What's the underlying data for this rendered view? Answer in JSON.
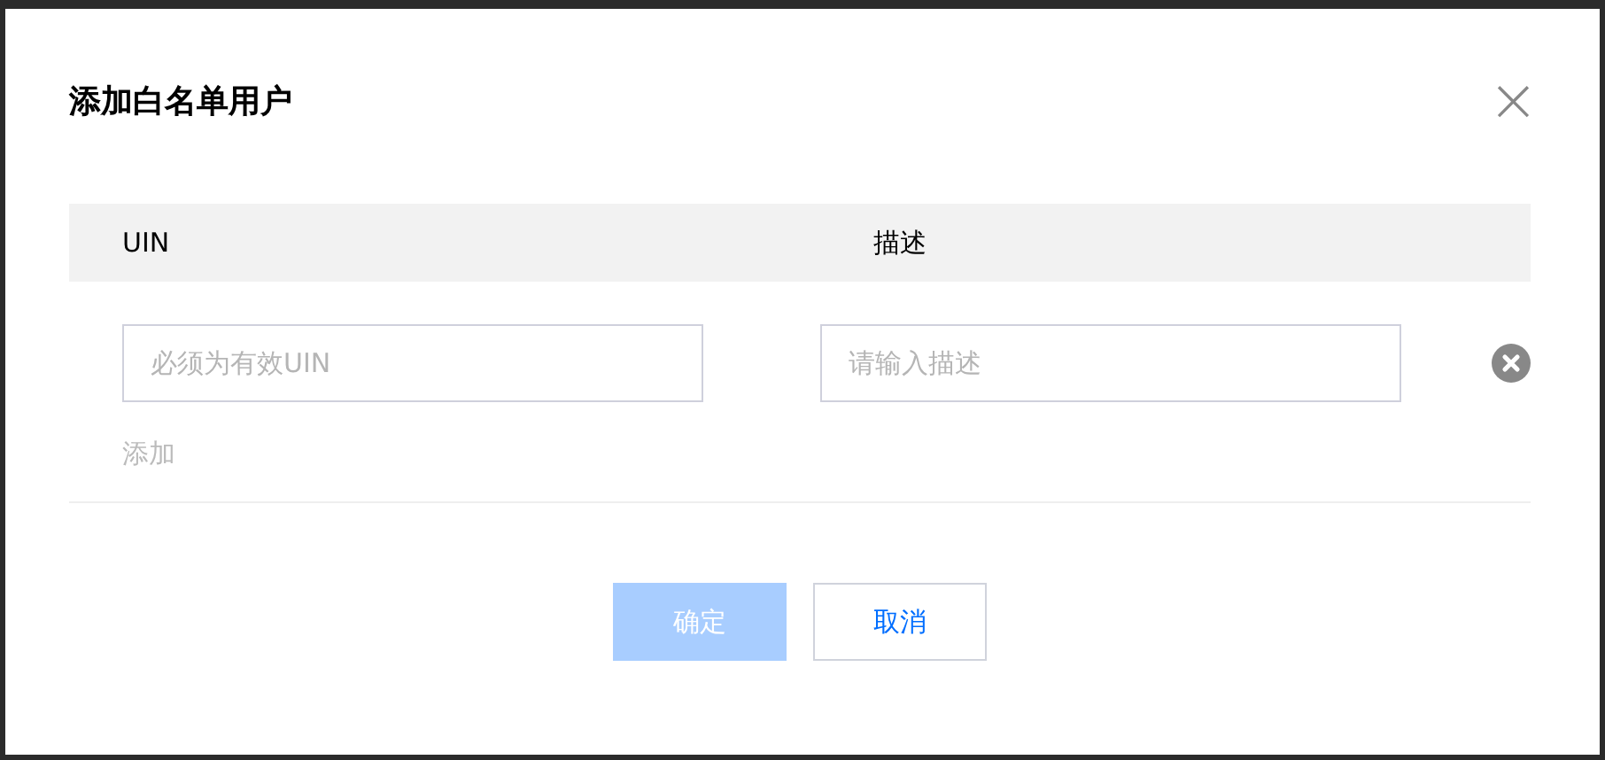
{
  "dialog": {
    "title": "添加白名单用户",
    "close_icon": "×"
  },
  "table": {
    "columns": [
      "UIN",
      "描述"
    ],
    "rows": [
      {
        "fields": [
          {
            "placeholder": "必须为有效UIN"
          },
          {
            "placeholder": "请输入描述"
          }
        ]
      }
    ]
  },
  "add_link": {
    "label": "添加",
    "disabled": true
  },
  "buttons": [
    {
      "label": "确定",
      "kind": "primary",
      "disabled": true
    },
    {
      "label": "取消",
      "kind": "default",
      "disabled": false
    }
  ]
}
